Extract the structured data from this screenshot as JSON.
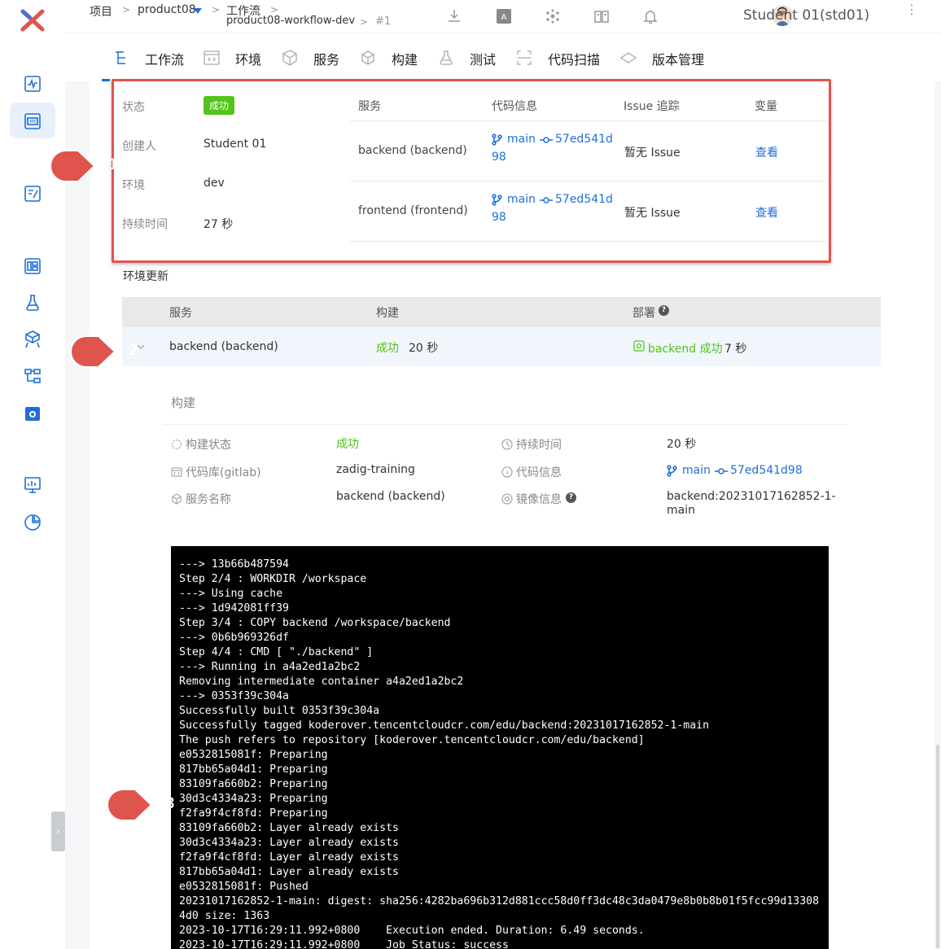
{
  "breadcrumb": {
    "project_label": "项目",
    "project": "product08",
    "workflow_label": "工作流",
    "workflow": "product08-workflow-dev",
    "run": "#1"
  },
  "user": {
    "name": "Student 01(std01)"
  },
  "tabs": [
    {
      "label": "工作流",
      "icon": "workflow-icon"
    },
    {
      "label": "环境",
      "icon": "environment-icon"
    },
    {
      "label": "服务",
      "icon": "service-icon"
    },
    {
      "label": "构建",
      "icon": "build-icon"
    },
    {
      "label": "测试",
      "icon": "test-icon"
    },
    {
      "label": "代码扫描",
      "icon": "scan-icon"
    },
    {
      "label": "版本管理",
      "icon": "version-icon"
    }
  ],
  "summary": {
    "status_label": "状态",
    "status_value": "成功",
    "creator_label": "创建人",
    "creator_value": "Student 01",
    "env_label": "环境",
    "env_value": "dev",
    "duration_label": "持续时间",
    "duration_value": "27 秒",
    "table_headers": [
      "服务",
      "代码信息",
      "Issue 追踪",
      "变量"
    ],
    "rows": [
      {
        "service": "backend (backend)",
        "branch": "main",
        "commit_a": "57ed541d",
        "commit_b": "98",
        "issue": "暂无 Issue",
        "vars": "查看"
      },
      {
        "service": "frontend (frontend)",
        "branch": "main",
        "commit_a": "57ed541d",
        "commit_b": "98",
        "issue": "暂无 Issue",
        "vars": "查看"
      }
    ]
  },
  "env_update": {
    "title": "环境更新",
    "headers": {
      "service": "服务",
      "build": "构建",
      "deploy": "部署"
    },
    "row": {
      "service": "backend (backend)",
      "build_status": "成功",
      "build_time": "20 秒",
      "deploy_name": "backend 成功",
      "deploy_time": "7 秒"
    }
  },
  "build_detail": {
    "title": "构建",
    "status_label": "构建状态",
    "status_value": "成功",
    "duration_label": "持续时间",
    "duration_value": "20 秒",
    "repo_label": "代码库(gitlab)",
    "repo_value": "zadig-training",
    "code_label": "代码信息",
    "code_branch": "main",
    "code_commit": "57ed541d98",
    "service_label": "服务名称",
    "service_value": "backend (backend)",
    "image_label": "镜像信息",
    "image_value_1": "backend:20231017162852-1-",
    "image_value_2": "main"
  },
  "markers": [
    "1",
    "2",
    "3"
  ],
  "log_lines": [
    "---> 13b66b487594",
    "Step 2/4 : WORKDIR /workspace",
    "---> Using cache",
    "---> 1d942081ff39",
    "Step 3/4 : COPY backend /workspace/backend",
    "---> 0b6b969326df",
    "Step 4/4 : CMD [ \"./backend\" ]",
    "---> Running in a4a2ed1a2bc2",
    "Removing intermediate container a4a2ed1a2bc2",
    "---> 0353f39c304a",
    "Successfully built 0353f39c304a",
    "Successfully tagged koderover.tencentcloudcr.com/edu/backend:20231017162852-1-main",
    "The push refers to repository [koderover.tencentcloudcr.com/edu/backend]",
    "e0532815081f: Preparing",
    "817bb65a04d1: Preparing",
    "83109fa660b2: Preparing",
    "30d3c4334a23: Preparing",
    "f2fa9f4cf8fd: Preparing",
    "83109fa660b2: Layer already exists",
    "30d3c4334a23: Layer already exists",
    "f2fa9f4cf8fd: Layer already exists",
    "817bb65a04d1: Layer already exists",
    "e0532815081f: Pushed",
    "20231017162852-1-main: digest: sha256:4282ba696b312d881ccc58d0ff3dc48c3da0479e8b0b8b01f5fcc99d133084d0 size: 1363",
    "2023-10-17T16:29:11.992+0800    Execution ended. Duration: 6.49 seconds.",
    "2023-10-17T16:29:11.992+0800    Job Status: success"
  ],
  "colors": {
    "accent": "#1f6fd8",
    "success": "#52c41a",
    "annotation": "#e0544e"
  }
}
